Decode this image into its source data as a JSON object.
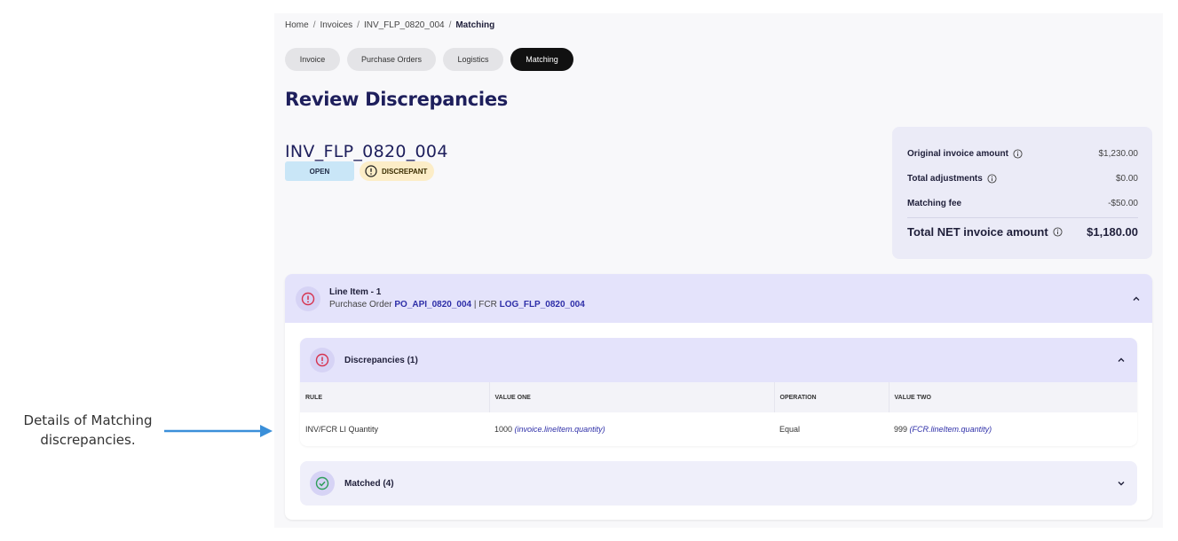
{
  "annotation": {
    "line1": "Details of Matching",
    "line2": "discrepancies."
  },
  "breadcrumb": {
    "items": [
      "Home",
      "Invoices",
      "INV_FLP_0820_004",
      "Matching"
    ],
    "separator": "/"
  },
  "tabs": [
    {
      "label": "Invoice",
      "active": false
    },
    {
      "label": "Purchase Orders",
      "active": false
    },
    {
      "label": "Logistics",
      "active": false
    },
    {
      "label": "Matching",
      "active": true
    }
  ],
  "page_title": "Review Discrepancies",
  "invoice": {
    "id": "INV_FLP_0820_004",
    "status_badge": "OPEN",
    "discrepancy_badge": "DISCREPANT"
  },
  "summary": {
    "original_label": "Original invoice amount",
    "original_value": "$1,230.00",
    "adjustments_label": "Total adjustments",
    "adjustments_value": "$0.00",
    "fee_label": "Matching fee",
    "fee_value": "-$50.00",
    "total_label": "Total NET invoice amount",
    "total_value": "$1,180.00"
  },
  "line_item": {
    "title": "Line Item - 1",
    "po_prefix": "Purchase Order",
    "po_ref": "PO_API_0820_004",
    "fcr_prefix": "| FCR",
    "fcr_ref": "LOG_FLP_0820_004"
  },
  "discrepancies": {
    "label": "Discrepancies (1)",
    "columns": [
      "RULE",
      "VALUE ONE",
      "OPERATION",
      "VALUE TWO"
    ],
    "rows": [
      {
        "rule": "INV/FCR LI Quantity",
        "value_one": "1000",
        "value_one_path": "(invoice.lineItem.quantity)",
        "operation": "Equal",
        "value_two": "999",
        "value_two_path": "(FCR.lineItem.quantity)"
      }
    ]
  },
  "matched": {
    "label": "Matched (4)"
  },
  "colors": {
    "accent": "#1e1f5c",
    "link": "#2e2fa8",
    "error": "#d6334f",
    "success": "#2f9e5b",
    "annotation_arrow": "#3a8fd9"
  }
}
